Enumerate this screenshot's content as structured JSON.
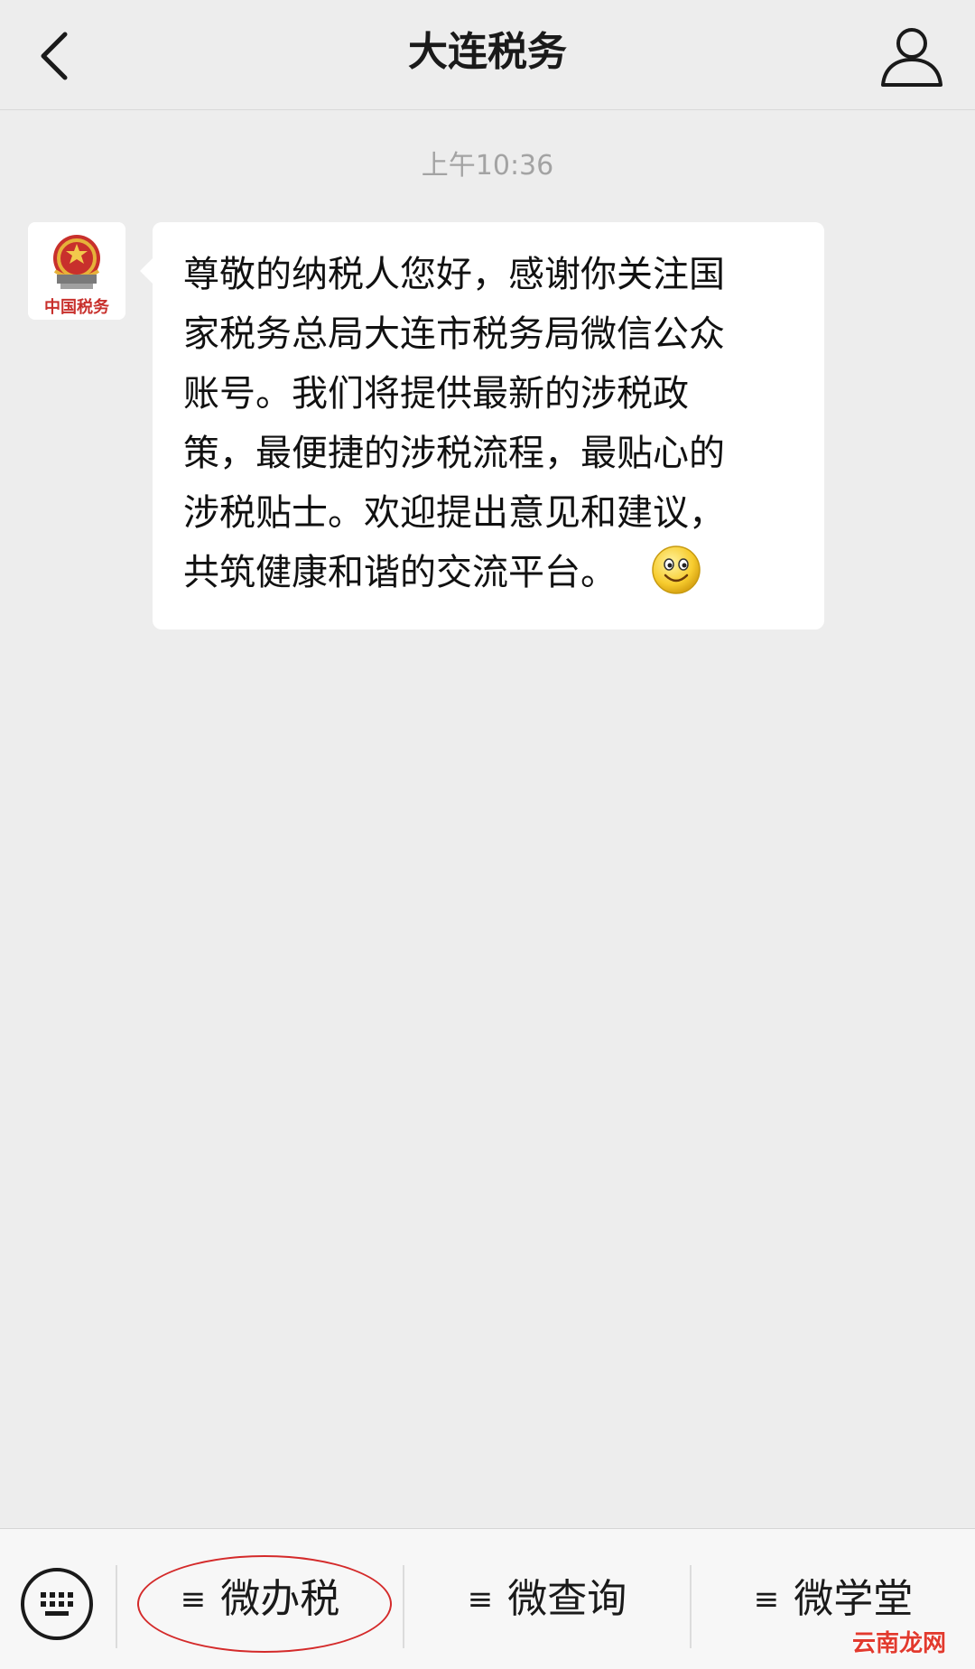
{
  "header": {
    "title": "大连税务",
    "back_icon": "chevron-left-icon",
    "profile_icon": "person-outline-icon"
  },
  "chat": {
    "timestamp": "上午10:36",
    "message": {
      "sender_avatar_icon": "national-emblem-logo",
      "avatar_caption": "中国税务",
      "lines": [
        "尊敬的纳税人您好，感谢你关注国",
        "家税务总局大连市税务局微信公众",
        "账号。我们将提供最新的涉税政",
        "策，最便捷的涉税流程，最贴心的",
        "涉税贴士。欢迎提出意见和建议，",
        "共筑健康和谐的交流平台。"
      ],
      "emoji": "smiley-icon"
    }
  },
  "menubar": {
    "keyboard_icon": "keyboard-icon",
    "menu_glyph": "≡",
    "items": [
      {
        "label": "微办税",
        "highlighted": true
      },
      {
        "label": "微查询"
      },
      {
        "label": "微学堂"
      }
    ],
    "highlight_color": "#d42a2a"
  },
  "watermark": "云南龙网"
}
